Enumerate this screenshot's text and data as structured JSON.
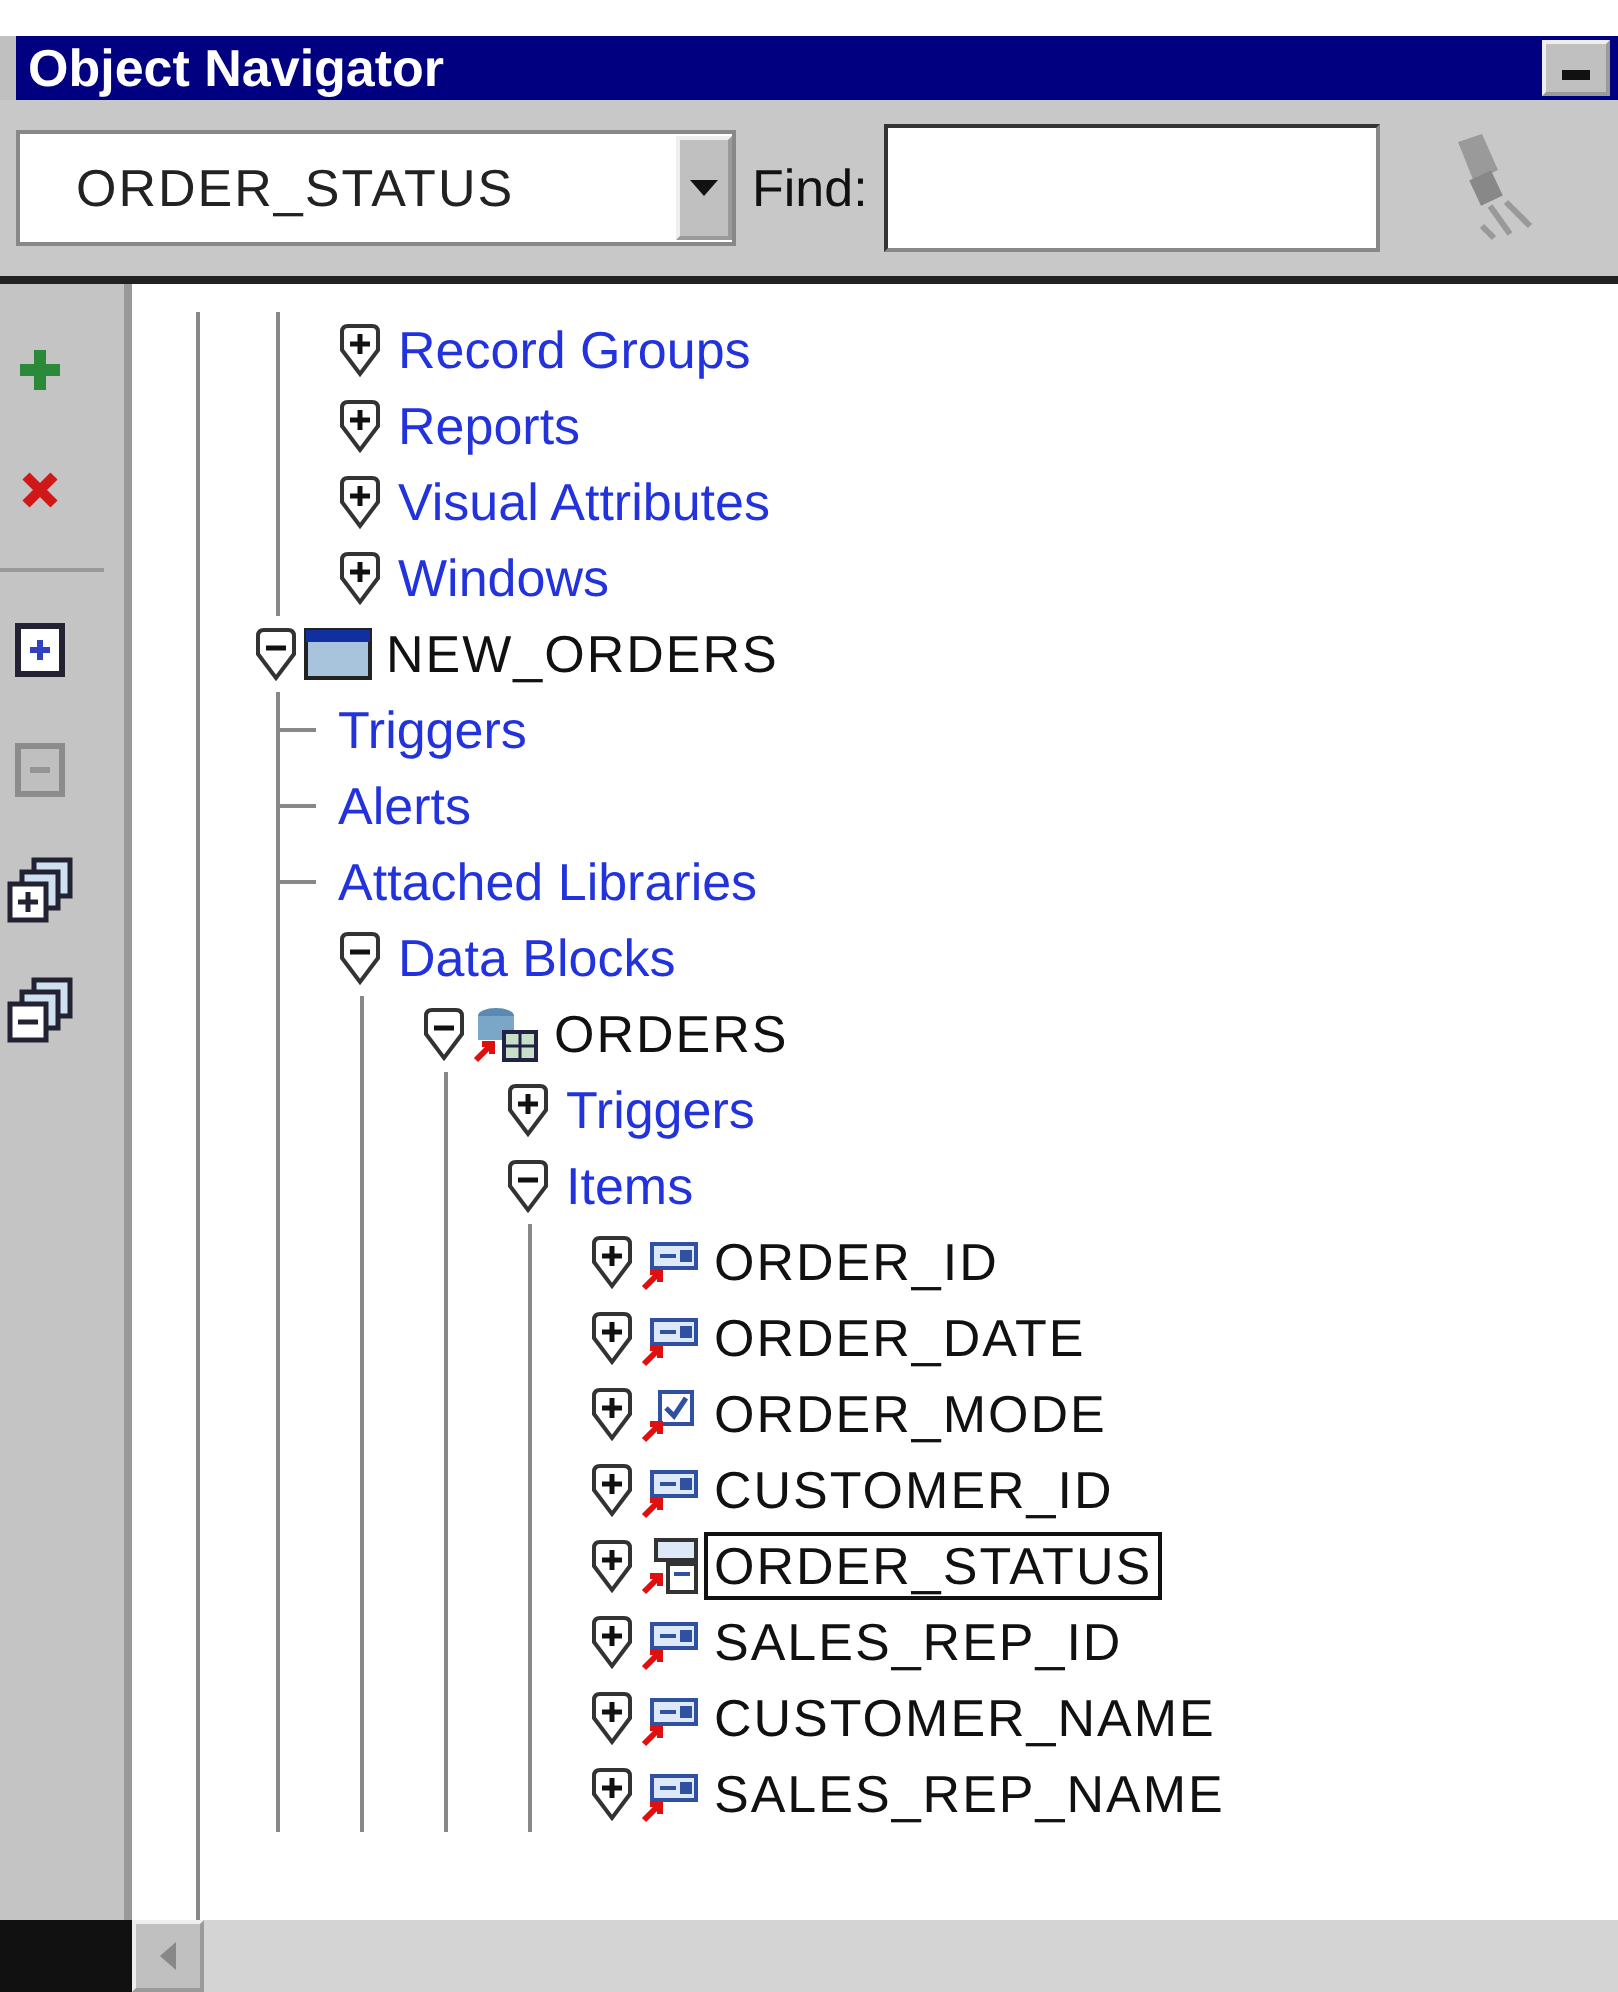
{
  "window": {
    "title": "Object Navigator"
  },
  "toolbar": {
    "context": "ORDER_STATUS",
    "find_label": "Find:"
  },
  "side_tools": [
    {
      "kind": "create",
      "disabled": false
    },
    {
      "kind": "delete",
      "disabled": false
    }
  ],
  "view_tools": [
    {
      "kind": "expand",
      "disabled": false
    },
    {
      "kind": "collapse",
      "disabled": true
    },
    {
      "kind": "expand_all",
      "disabled": false
    },
    {
      "kind": "collapse_all",
      "disabled": false
    }
  ],
  "tree": {
    "clipped_branch": [
      {
        "label": "Record Groups",
        "kind": "category",
        "leaf": false,
        "expanded": false,
        "selected": false
      },
      {
        "label": "Reports",
        "kind": "category",
        "leaf": false,
        "expanded": false,
        "selected": false
      },
      {
        "label": "Visual Attributes",
        "kind": "category",
        "leaf": false,
        "expanded": false,
        "selected": false
      },
      {
        "label": "Windows",
        "kind": "category",
        "leaf": false,
        "expanded": false,
        "selected": false
      }
    ],
    "nodes": [
      {
        "label": "NEW_ORDERS",
        "kind": "form",
        "leaf": false,
        "expanded": true,
        "selected": false,
        "children": [
          {
            "label": "Triggers",
            "kind": "category",
            "leaf": true,
            "selected": false
          },
          {
            "label": "Alerts",
            "kind": "category",
            "leaf": true,
            "selected": false
          },
          {
            "label": "Attached Libraries",
            "kind": "category",
            "leaf": true,
            "selected": false
          },
          {
            "label": "Data Blocks",
            "kind": "category",
            "leaf": false,
            "expanded": true,
            "selected": false,
            "children": [
              {
                "label": "ORDERS",
                "kind": "block",
                "leaf": false,
                "expanded": true,
                "selected": false,
                "children": [
                  {
                    "label": "Triggers",
                    "kind": "category",
                    "leaf": false,
                    "expanded": false,
                    "selected": false
                  },
                  {
                    "label": "Items",
                    "kind": "category",
                    "leaf": false,
                    "expanded": true,
                    "selected": false,
                    "children": [
                      {
                        "label": "ORDER_ID",
                        "kind": "text_item",
                        "leaf": false,
                        "expanded": false,
                        "selected": false
                      },
                      {
                        "label": "ORDER_DATE",
                        "kind": "text_item",
                        "leaf": false,
                        "expanded": false,
                        "selected": false
                      },
                      {
                        "label": "ORDER_MODE",
                        "kind": "checkbox",
                        "leaf": false,
                        "expanded": false,
                        "selected": false
                      },
                      {
                        "label": "CUSTOMER_ID",
                        "kind": "text_item",
                        "leaf": false,
                        "expanded": false,
                        "selected": false
                      },
                      {
                        "label": "ORDER_STATUS",
                        "kind": "list_item",
                        "leaf": false,
                        "expanded": false,
                        "selected": true
                      },
                      {
                        "label": "SALES_REP_ID",
                        "kind": "text_item",
                        "leaf": false,
                        "expanded": false,
                        "selected": false
                      },
                      {
                        "label": "CUSTOMER_NAME",
                        "kind": "text_item",
                        "leaf": false,
                        "expanded": false,
                        "selected": false
                      },
                      {
                        "label": "SALES_REP_NAME",
                        "kind": "text_item",
                        "leaf": false,
                        "expanded": false,
                        "selected": false
                      }
                    ]
                  }
                ]
              }
            ]
          }
        ]
      }
    ]
  }
}
